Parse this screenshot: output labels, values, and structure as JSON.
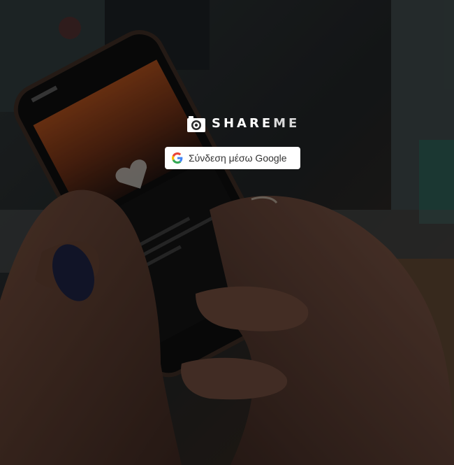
{
  "app": {
    "brand_name_main": "SHARE",
    "brand_name_accent": "ME",
    "logo_icon": "camera-icon"
  },
  "login": {
    "google_button_label": "Σύνδεση μέσω Google",
    "google_icon": "google-g-icon"
  },
  "colors": {
    "button_bg": "#ffffff",
    "button_text": "#333333",
    "brand_text": "#ffffff",
    "overlay": "rgba(0,0,0,0.38)"
  }
}
